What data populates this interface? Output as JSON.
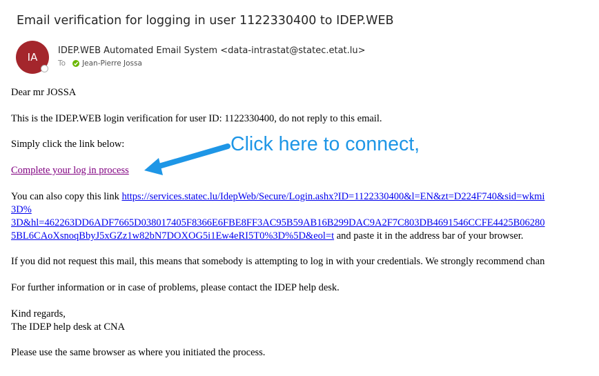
{
  "email": {
    "subject": "Email verification for logging in user 1122330400 to IDEP.WEB",
    "avatar_initials": "IA",
    "sender": "IDEP.WEB Automated Email System <data-intrastat@statec.etat.lu>",
    "to_label": "To",
    "recipient": "Jean-Pierre Jossa"
  },
  "body": {
    "greeting": "Dear mr JOSSA",
    "intro": "This is the IDEP.WEB login verification for user ID: 1122330400, do not reply to this email.",
    "click_prompt": "Simply click the link below:",
    "link_text": "Complete your log in process",
    "copy_prefix": "You can also copy this link ",
    "copy_url_line1": "https://services.statec.lu/IdepWeb/Secure/Login.ashx?ID=1122330400&l=EN&zt=D224F740&sid=wkmi",
    "copy_url_line2": "3D%",
    "copy_url_line3": "3D&hl=462263DD6ADF7665D038017405F8366E6FBE8FF3AC95B59AB16B299DAC9A2F7C803DB4691546CCFE4425B06280",
    "copy_url_line4": "5BL6CAoXsnoqBbyJ5xGZz1w82bN7DOXOG5i1Ew4eRI5T0%3D%5D&eol=t",
    "copy_suffix": " and paste it in the address bar of your browser.",
    "warning": "If you did not request this mail, this means that somebody is attempting to log in with your credentials. We strongly recommend chan",
    "help": "For further information or in case of problems, please contact the IDEP help desk.",
    "regards": "Kind regards,",
    "signature": "The IDEP help desk at CNA",
    "browser_note": "Please use the same browser as where you initiated the process."
  },
  "annotation": {
    "callout_text": "Click here to connect,",
    "color": "#1e96e6"
  },
  "colors": {
    "avatar_bg": "#a4262c",
    "link": "#0000ee",
    "visited_link": "#800080",
    "presence_ok": "#6bb700"
  }
}
